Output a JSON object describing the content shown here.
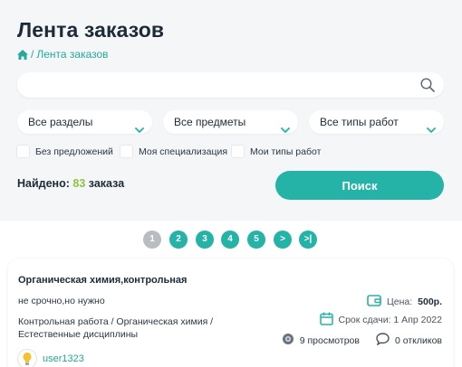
{
  "header": {
    "title": "Лента заказов",
    "breadcrumb_current": "Лента заказов"
  },
  "search": {
    "value": "",
    "placeholder": ""
  },
  "filters": {
    "sections": "Все разделы",
    "subjects": "Все предметы",
    "work_types": "Все типы работ"
  },
  "checkboxes": {
    "no_offers": "Без предложений",
    "my_specialization": "Моя специализация",
    "my_work_types": "Мои типы работ"
  },
  "results": {
    "found_label": "Найдено:",
    "count": "83",
    "unit": "заказа"
  },
  "search_button": "Поиск",
  "pagination": {
    "pages": [
      "1",
      "2",
      "3",
      "4",
      "5"
    ],
    "next": ">",
    "last": ">|",
    "active": "1"
  },
  "order": {
    "title": "Органическая химия,контрольная",
    "description": "не срочно,но нужно",
    "category": "Контрольная работа / Органическая химия / Естественные дисциплины",
    "price_label": "Цена:",
    "price_value": "500р.",
    "deadline": "Срок сдачи: 1 Апр 2022",
    "views": "9 просмотров",
    "responses": "0 откликов",
    "user": "user1323"
  },
  "colors": {
    "accent": "#24b3a6",
    "count_green": "#8cc63f",
    "pager_inactive": "#b9bcc0"
  }
}
